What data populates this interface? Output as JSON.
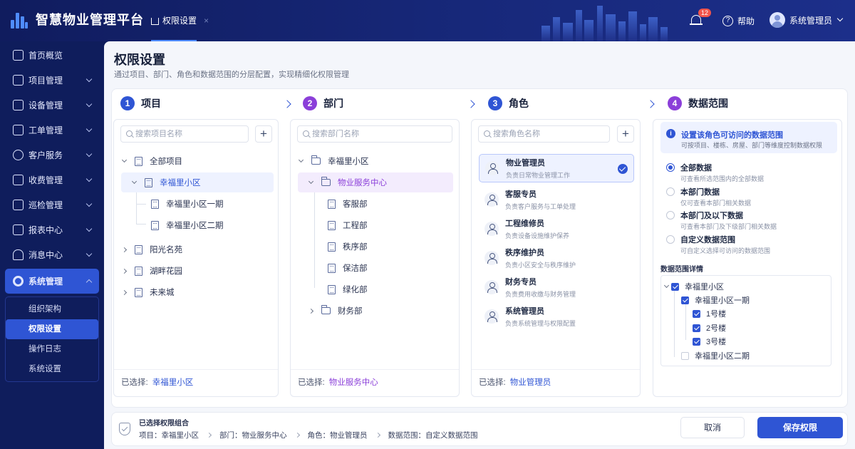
{
  "app": {
    "title": "智慧物业管理平台"
  },
  "topbar": {
    "tab_label": "权限设置",
    "tab_close": "×",
    "notification_count": "12",
    "help_label": "帮助",
    "user_name": "系统管理员"
  },
  "sidebar": {
    "items": [
      {
        "label": "首页概览",
        "icon": "home-icon"
      },
      {
        "label": "项目管理",
        "icon": "building-icon"
      },
      {
        "label": "设备管理",
        "icon": "device-icon"
      },
      {
        "label": "工单管理",
        "icon": "ticket-icon"
      },
      {
        "label": "客户服务",
        "icon": "customer-icon"
      },
      {
        "label": "收费管理",
        "icon": "billing-icon"
      },
      {
        "label": "巡检管理",
        "icon": "inspection-icon"
      },
      {
        "label": "报表中心",
        "icon": "report-icon"
      },
      {
        "label": "消息中心",
        "icon": "message-icon"
      },
      {
        "label": "系统管理",
        "icon": "settings-icon"
      }
    ],
    "sub_items": [
      "组织架构",
      "权限设置",
      "操作日志",
      "系统设置"
    ]
  },
  "page": {
    "title": "权限设置",
    "subtitle": "通过项目、部门、角色和数据范围的分层配置，实现精细化权限管理"
  },
  "steps": [
    {
      "num": "1",
      "label": "项目",
      "color": "#2f55d4"
    },
    {
      "num": "2",
      "label": "部门",
      "color": "#8b3fd9"
    },
    {
      "num": "3",
      "label": "角色",
      "color": "#2f55d4"
    },
    {
      "num": "4",
      "label": "数据范围",
      "color": "#8b3fd9"
    }
  ],
  "projects": {
    "search_placeholder": "搜索项目名称",
    "root": "全部项目",
    "items": [
      "幸福里小区",
      "幸福里小区一期",
      "幸福里小区二期",
      "阳光名苑",
      "湖畔花园",
      "未来城"
    ],
    "selected_label": "已选择:",
    "selected_value": "幸福里小区"
  },
  "departments": {
    "search_placeholder": "搜索部门名称",
    "root": "幸福里小区",
    "group": "物业服务中心",
    "items": [
      "客服部",
      "工程部",
      "秩序部",
      "保洁部",
      "绿化部"
    ],
    "other": "财务部",
    "selected_label": "已选择:",
    "selected_value": "物业服务中心"
  },
  "roles": {
    "search_placeholder": "搜索角色名称",
    "items": [
      {
        "name": "物业管理员",
        "desc": "负责日常物业管理工作"
      },
      {
        "name": "客服专员",
        "desc": "负责客户服务与工单处理"
      },
      {
        "name": "工程维修员",
        "desc": "负责设备设施维护保养"
      },
      {
        "name": "秩序维护员",
        "desc": "负责小区安全与秩序维护"
      },
      {
        "name": "财务专员",
        "desc": "负责费用收缴与财务管理"
      },
      {
        "name": "系统管理员",
        "desc": "负责系统管理与权限配置"
      }
    ],
    "selected_label": "已选择:",
    "selected_value": "物业管理员"
  },
  "scope": {
    "info_title": "设置该角色可访问的数据范围",
    "info_desc": "可按项目、楼栋、房屋、部门等维度控制数据权限",
    "options": [
      {
        "label": "全部数据",
        "desc": "可查看所选范围内的全部数据"
      },
      {
        "label": "本部门数据",
        "desc": "仅可查看本部门相关数据"
      },
      {
        "label": "本部门及以下数据",
        "desc": "可查看本部门及下级部门相关数据"
      },
      {
        "label": "自定义数据范围",
        "desc": "可自定义选择可访问的数据范围"
      }
    ],
    "detail_title": "数据范围详情",
    "detail": [
      "幸福里小区",
      "幸福里小区一期",
      "1号楼",
      "2号楼",
      "3号楼",
      "幸福里小区二期"
    ]
  },
  "bottom": {
    "title": "已选择权限组合",
    "combo": [
      "项目：幸福里小区",
      "部门：物业服务中心",
      "角色：物业管理员",
      "数据范围：自定义数据范围"
    ],
    "cancel_label": "取消",
    "save_label": "保存权限"
  },
  "colors": {
    "primary": "#2f55d4",
    "purple": "#8b3fd9",
    "nav_bg": "#0f1d5c"
  }
}
